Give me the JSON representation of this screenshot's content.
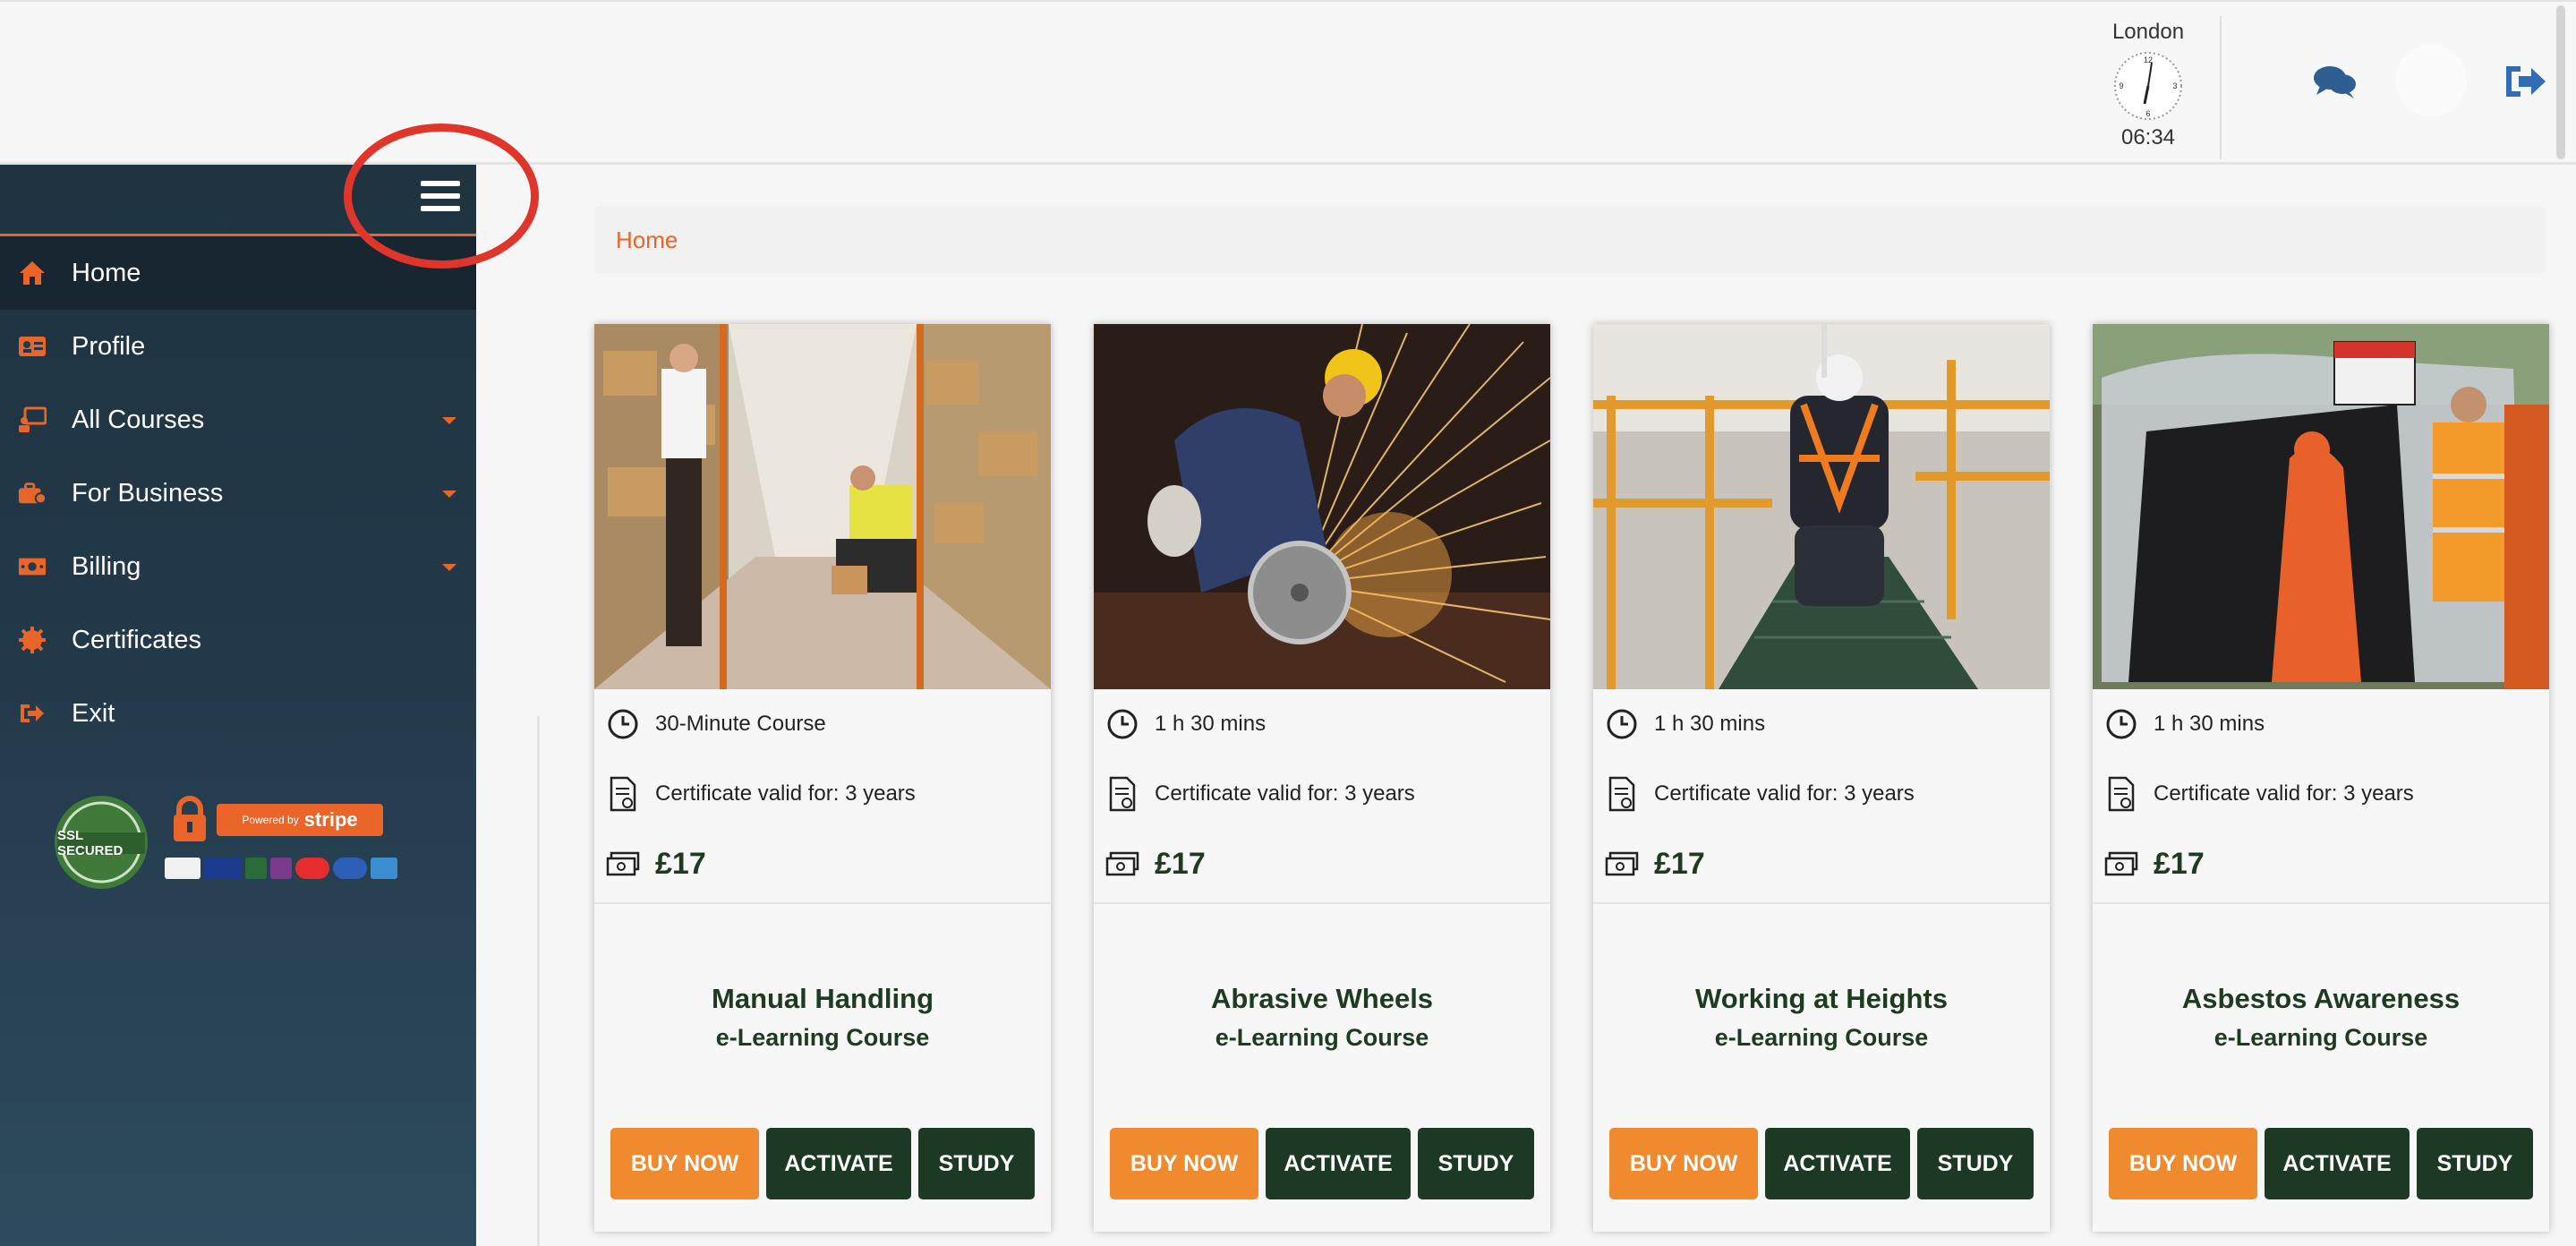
{
  "header": {
    "clock_city": "London",
    "clock_time": "06:34"
  },
  "sidebar": {
    "items": [
      {
        "label": "Home",
        "icon": "home-icon",
        "has_dropdown": false
      },
      {
        "label": "Profile",
        "icon": "id-card-icon",
        "has_dropdown": false
      },
      {
        "label": "All Courses",
        "icon": "teacher-icon",
        "has_dropdown": true
      },
      {
        "label": "For Business",
        "icon": "business-icon",
        "has_dropdown": true
      },
      {
        "label": "Billing",
        "icon": "money-icon",
        "has_dropdown": true
      },
      {
        "label": "Certificates",
        "icon": "certificate-icon",
        "has_dropdown": false
      },
      {
        "label": "Exit",
        "icon": "sign-out-icon",
        "has_dropdown": false
      }
    ],
    "ssl_badge_text": "SSL SECURED",
    "stripe_small": "Powered by",
    "stripe_brand": "stripe"
  },
  "breadcrumb": {
    "home": "Home"
  },
  "courses": [
    {
      "duration": "30-Minute Course",
      "certificate": "Certificate valid for: 3 years",
      "price": "£17",
      "title": "Manual Handling",
      "subtitle": "e-Learning Course",
      "buy": "BUY NOW",
      "activate": "ACTIVATE",
      "study": "STUDY"
    },
    {
      "duration": "1 h 30 mins",
      "certificate": "Certificate valid for: 3 years",
      "price": "£17",
      "title": "Abrasive Wheels",
      "subtitle": "e-Learning Course",
      "buy": "BUY NOW",
      "activate": "ACTIVATE",
      "study": "STUDY"
    },
    {
      "duration": "1 h 30 mins",
      "certificate": "Certificate valid for: 3 years",
      "price": "£17",
      "title": "Working at Heights",
      "subtitle": "e-Learning Course",
      "buy": "BUY NOW",
      "activate": "ACTIVATE",
      "study": "STUDY"
    },
    {
      "duration": "1 h 30 mins",
      "certificate": "Certificate valid for: 3 years",
      "price": "£17",
      "title": "Asbestos Awareness",
      "subtitle": "e-Learning Course",
      "buy": "BUY NOW",
      "activate": "ACTIVATE",
      "study": "STUDY"
    }
  ],
  "colors": {
    "accent": "#e9652a",
    "sidebar_bg": "#22394a",
    "button_green": "#1c3a23",
    "button_orange": "#ef8a2e",
    "highlight": "#e0352b"
  }
}
